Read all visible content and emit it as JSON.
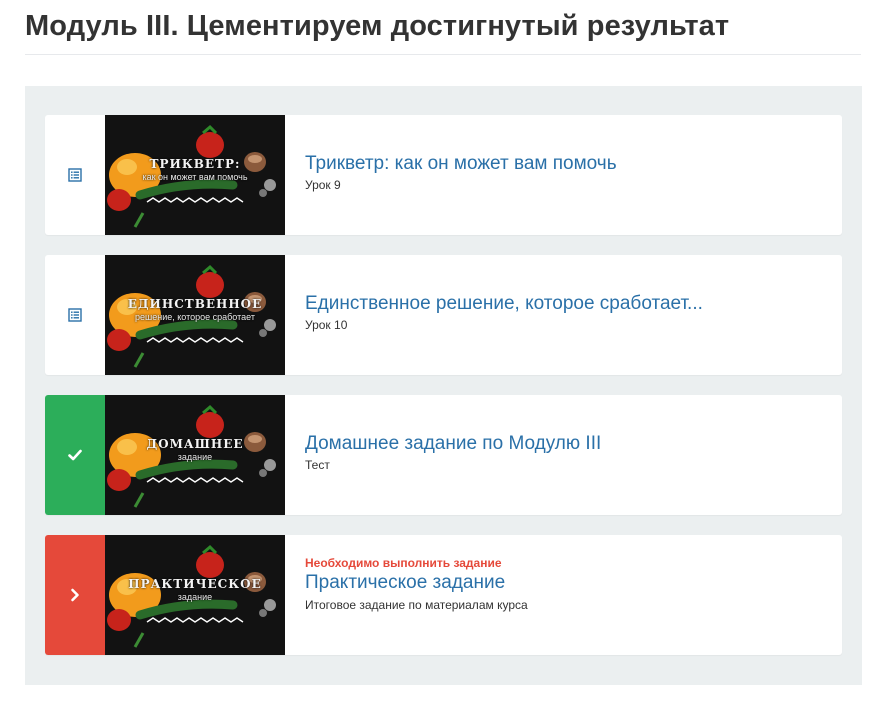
{
  "module": {
    "title": "Модуль III. Цементируем достигнутый результат"
  },
  "lessons": [
    {
      "status": "not-started",
      "status_icon": "document-list-icon",
      "thumb_title": "Трикветр:",
      "thumb_subtitle": "как он может вам помочь",
      "title": "Трикветр: как он может вам помочь",
      "meta": "Урок 9"
    },
    {
      "status": "not-started",
      "status_icon": "document-list-icon",
      "thumb_title": "Единственное",
      "thumb_subtitle": "решение, которое сработает",
      "title": "Единственное решение, которое сработает...",
      "meta": "Урок 10"
    },
    {
      "status": "done",
      "status_icon": "checkmark-icon",
      "thumb_title": "Домашнее",
      "thumb_subtitle": "задание",
      "title": "Домашнее задание по Модулю III",
      "meta": "Тест"
    },
    {
      "status": "required",
      "status_icon": "chevron-right-icon",
      "thumb_title": "Практическое",
      "thumb_subtitle": "задание",
      "warning": "Необходимо выполнить задание",
      "title": "Практическое задание",
      "description": "Итоговое задание по материалам курса"
    }
  ],
  "colors": {
    "link": "#2a70a8",
    "done": "#2cae5a",
    "required": "#e5493a",
    "panel_bg": "#ebeff0"
  }
}
